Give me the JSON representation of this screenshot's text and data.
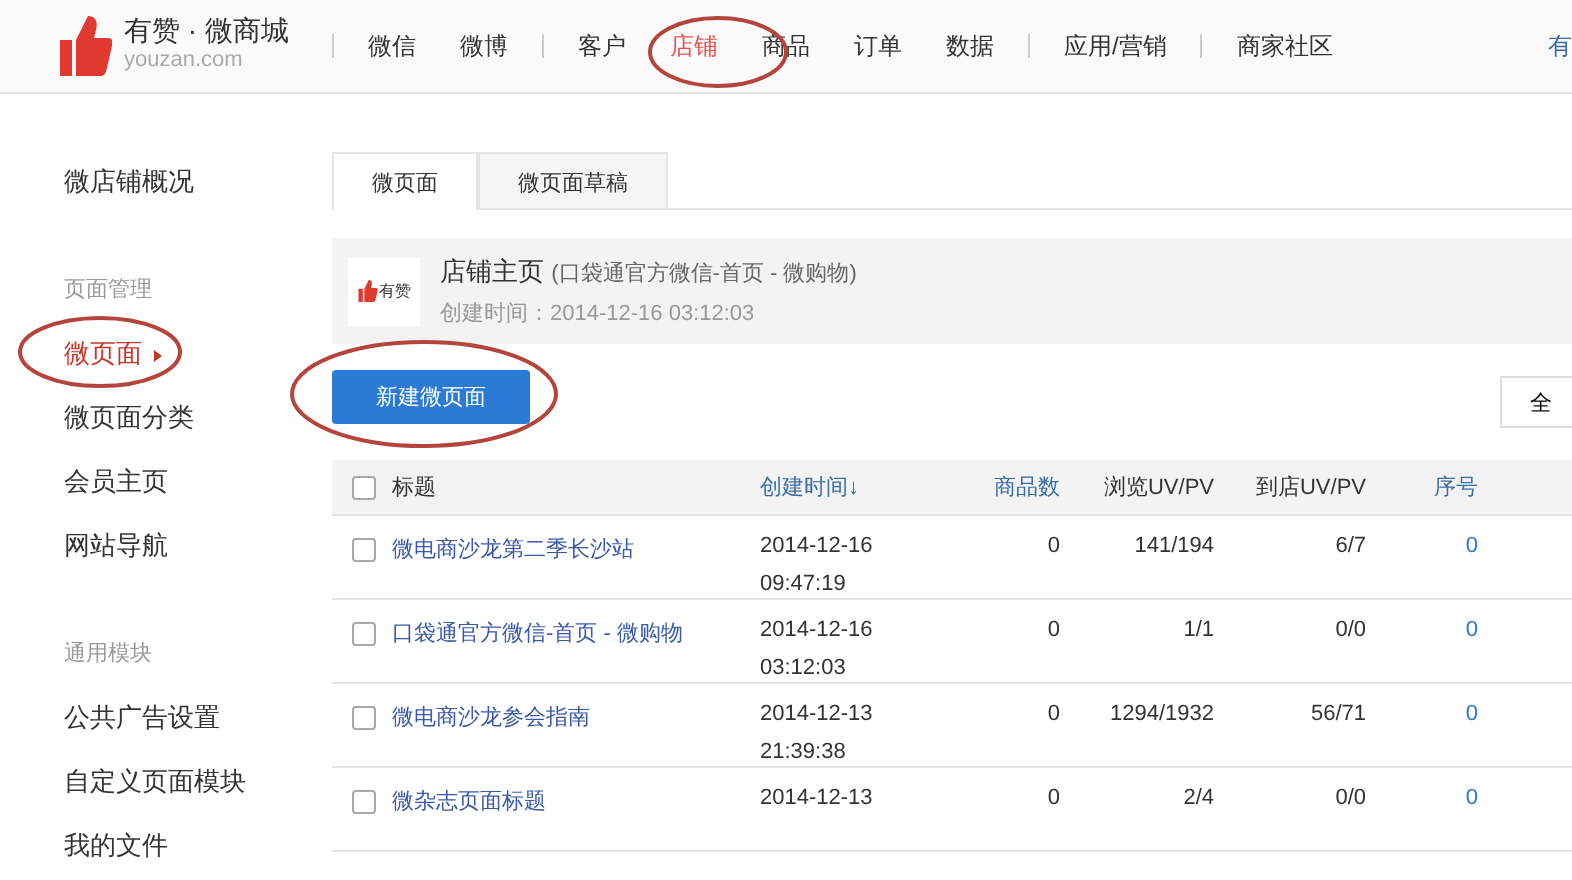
{
  "header": {
    "brand": "有赞 · 微商城",
    "domain": "youzan.com",
    "nav": [
      {
        "label": "微信",
        "selected": false,
        "divider_before": true
      },
      {
        "label": "微博",
        "selected": false,
        "divider_before": false
      },
      {
        "label": "客户",
        "selected": false,
        "divider_before": true
      },
      {
        "label": "店铺",
        "selected": true,
        "divider_before": false
      },
      {
        "label": "商品",
        "selected": false,
        "divider_before": false
      },
      {
        "label": "订单",
        "selected": false,
        "divider_before": false
      },
      {
        "label": "数据",
        "selected": false,
        "divider_before": false
      },
      {
        "label": "应用/营销",
        "selected": false,
        "divider_before": true
      },
      {
        "label": "商家社区",
        "selected": false,
        "divider_before": true
      }
    ],
    "right_link": "有"
  },
  "sidebar": {
    "items": [
      {
        "kind": "item",
        "label": "微店铺概况",
        "selected": false
      },
      {
        "kind": "heading",
        "label": "页面管理"
      },
      {
        "kind": "item",
        "label": "微页面",
        "selected": true
      },
      {
        "kind": "item",
        "label": "微页面分类",
        "selected": false
      },
      {
        "kind": "item",
        "label": "会员主页",
        "selected": false
      },
      {
        "kind": "item",
        "label": "网站导航",
        "selected": false
      },
      {
        "kind": "heading",
        "label": "通用模块"
      },
      {
        "kind": "item",
        "label": "公共广告设置",
        "selected": false
      },
      {
        "kind": "item",
        "label": "自定义页面模块",
        "selected": false
      },
      {
        "kind": "item",
        "label": "我的文件",
        "selected": false
      }
    ]
  },
  "tabs": [
    {
      "label": "微页面",
      "selected": true
    },
    {
      "label": "微页面草稿",
      "selected": false
    }
  ],
  "homepage": {
    "logo_text": "有赞",
    "title": "店铺主页",
    "subtitle": "(口袋通官方微信-首页 - 微购物)",
    "created": "创建时间：2014-12-16 03:12:03"
  },
  "new_button": "新建微页面",
  "filter_button": "全",
  "table": {
    "select_all_checked": false,
    "columns": [
      {
        "label": "标题",
        "sortable": false
      },
      {
        "label": "创建时间↓",
        "sortable": true
      },
      {
        "label": "商品数",
        "sortable": true
      },
      {
        "label": "浏览UV/PV",
        "sortable": false
      },
      {
        "label": "到店UV/PV",
        "sortable": false
      },
      {
        "label": "序号",
        "sortable": true
      }
    ],
    "rows": [
      {
        "checked": false,
        "title": "微电商沙龙第二季长沙站",
        "date": "2014-12-16",
        "time": "09:47:19",
        "goods": "0",
        "views": "141/194",
        "visits": "6/7",
        "order": "0"
      },
      {
        "checked": false,
        "title": "口袋通官方微信-首页 - 微购物",
        "date": "2014-12-16",
        "time": "03:12:03",
        "goods": "0",
        "views": "1/1",
        "visits": "0/0",
        "order": "0"
      },
      {
        "checked": false,
        "title": "微电商沙龙参会指南",
        "date": "2014-12-13",
        "time": "21:39:38",
        "goods": "0",
        "views": "1294/1932",
        "visits": "56/71",
        "order": "0"
      },
      {
        "checked": false,
        "title": "微杂志页面标题",
        "date": "2014-12-13",
        "time": "",
        "goods": "0",
        "views": "2/4",
        "visits": "0/0",
        "order": "0"
      }
    ]
  }
}
